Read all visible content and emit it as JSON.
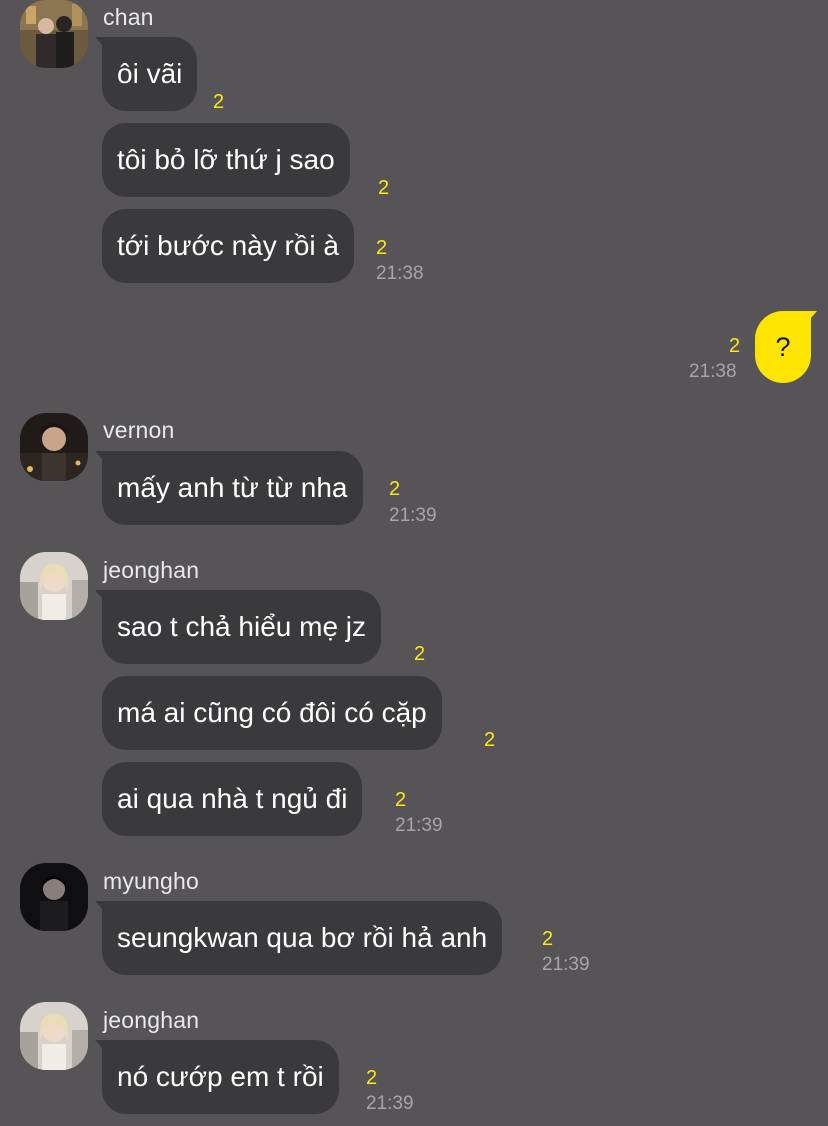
{
  "colors": {
    "background": "#565456",
    "bubble_other": "#3a393b",
    "bubble_mine": "#fee500",
    "unread_count": "#ffe812",
    "timestamp": "#a6a5a7"
  },
  "messages": [
    {
      "sender": "chan",
      "avatar": "avatar-photo",
      "lines": [
        {
          "text": "ôi vãi",
          "count": "2"
        },
        {
          "text": "tôi bỏ lỡ thứ j sao",
          "count": "2"
        },
        {
          "text": "tới bước này rồi à",
          "count": "2"
        }
      ],
      "time": "21:38"
    },
    {
      "sender": "me",
      "lines": [
        {
          "text": "?",
          "count": "2"
        }
      ],
      "time": "21:38"
    },
    {
      "sender": "vernon",
      "avatar": "avatar-photo",
      "lines": [
        {
          "text": "mấy anh từ từ nha",
          "count": "2"
        }
      ],
      "time": "21:39"
    },
    {
      "sender": "jeonghan",
      "avatar": "avatar-photo",
      "lines": [
        {
          "text": "sao t chả hiểu mẹ jz",
          "count": "2"
        },
        {
          "text": "má ai cũng có đôi có cặp",
          "count": "2"
        },
        {
          "text": "ai qua nhà t ngủ đi",
          "count": "2"
        }
      ],
      "time": "21:39"
    },
    {
      "sender": "myungho",
      "avatar": "avatar-photo",
      "lines": [
        {
          "text": "seungkwan qua bơ rồi hả anh",
          "count": "2"
        }
      ],
      "time": "21:39"
    },
    {
      "sender": "jeonghan",
      "avatar": "avatar-photo",
      "lines": [
        {
          "text": "nó cướp em t rồi",
          "count": "2"
        }
      ],
      "time": "21:39"
    }
  ]
}
